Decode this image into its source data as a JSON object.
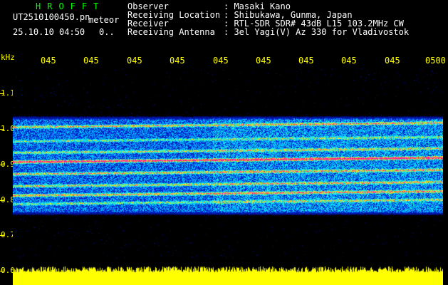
{
  "header": {
    "title": "HROFFT",
    "filename": "UT2510100450.pn",
    "tag": "meteor",
    "timestamp": "25.10.10 04:50",
    "frac": "0.."
  },
  "meta": [
    {
      "key": "Observer",
      "value": ": Masaki Kano"
    },
    {
      "key": "Receiving Location",
      "value": ": Shibukawa, Gunma, Japan"
    },
    {
      "key": "Receiver",
      "value": ": RTL-SDR SDR# 43dB L15 103.2MHz CW"
    },
    {
      "key": "Receiving Antenna",
      "value": ": 3el Yagi(V) Az 330 for Vladivostok"
    }
  ],
  "axis": {
    "unit": "kHz",
    "y_labels": [
      "1.1",
      "1.0",
      "0.9",
      "0.8",
      "0.7",
      "0.6"
    ],
    "x_labels": [
      "045",
      "045",
      "045",
      "045",
      "045",
      "045",
      "045",
      "045",
      "045",
      "0500"
    ]
  },
  "colors": {
    "axis": "#ffff00",
    "title": "#00ff00",
    "text": "#ffffff"
  }
}
